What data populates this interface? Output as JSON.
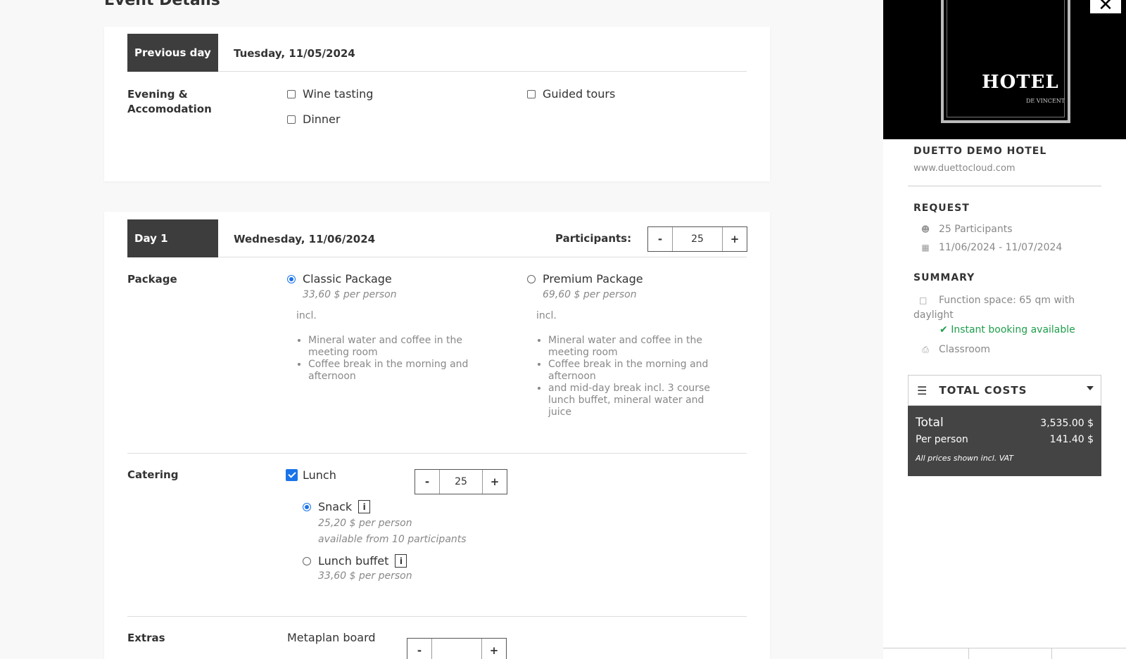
{
  "page": {
    "title": "Event Details"
  },
  "previous_day": {
    "tag": "Previous day",
    "date": "Tuesday, 11/05/2024",
    "section_label": "Evening & Accomodation",
    "options": [
      {
        "label": "Wine tasting",
        "checked": false
      },
      {
        "label": "Guided tours",
        "checked": false
      },
      {
        "label": "Dinner",
        "checked": false
      }
    ]
  },
  "day1": {
    "tag": "Day 1",
    "date": "Wednesday, 11/06/2024",
    "participants_label": "Participants:",
    "participants_value": "25",
    "minus": "-",
    "plus": "+",
    "package": {
      "label": "Package",
      "options": [
        {
          "name": "Classic Package",
          "price": "33,60 $ per person",
          "incl": "incl.",
          "selected": true,
          "items": [
            "Mineral water and coffee in the meeting room",
            "Coffee break in the morning and afternoon"
          ]
        },
        {
          "name": "Premium Package",
          "price": "69,60 $ per person",
          "incl": "incl.",
          "selected": false,
          "items": [
            "Mineral water and coffee in the meeting room",
            "Coffee break in the morning and afternoon",
            "and mid-day break incl. 3 course lunch buffet, mineral water and juice"
          ]
        }
      ]
    },
    "catering": {
      "label": "Catering",
      "lunch_label": "Lunch",
      "lunch_checked": true,
      "lunch_qty": "25",
      "info_glyph": "i",
      "options": [
        {
          "name": "Snack",
          "price": "25,20 $ per person",
          "note": "available from 10 participants",
          "selected": true
        },
        {
          "name": "Lunch buffet",
          "price": "33,60 $ per person",
          "selected": false
        }
      ]
    },
    "extras": {
      "label": "Extras",
      "item": "Metaplan board"
    }
  },
  "sidebar": {
    "image_word": "HOTEL",
    "image_sub": "DE VINCENT",
    "close_glyph": "✕",
    "hotel_name": "DUETTO DEMO HOTEL",
    "url": "www.duettocloud.com",
    "request_heading": "REQUEST",
    "participants": "25 Participants",
    "dates": "11/06/2024 - 11/07/2024",
    "summary_heading": "SUMMARY",
    "function_space": "Function space: 65 qm with daylight",
    "instant": "Instant booking available",
    "seating": "Classroom",
    "costs_heading": "TOTAL COSTS",
    "total_label": "Total",
    "total_value": "3,535.00 $",
    "per_person_label": "Per person",
    "per_person_value": "141.40 $",
    "vat_note": "All prices shown incl. VAT"
  },
  "colors": {
    "accent": "#1a73e8",
    "dark": "#3d3d3d",
    "success": "#1e9e4b"
  },
  "icons": [
    "users-icon",
    "calendar-icon",
    "expand-icon",
    "check-icon",
    "chair-icon",
    "menu-icon",
    "chevron-down-icon",
    "close-icon",
    "info-icon"
  ]
}
